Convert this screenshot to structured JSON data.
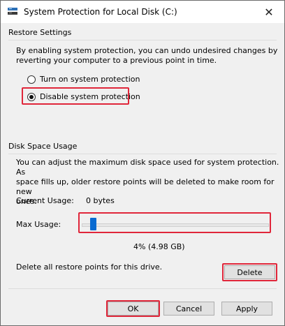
{
  "window": {
    "title": "System Protection for Local Disk (C:)",
    "close_glyph": "✕"
  },
  "restore_settings": {
    "heading": "Restore Settings",
    "description_line1": "By enabling system protection, you can undo undesired changes by",
    "description_line2": "reverting your computer to a previous point in time.",
    "options": [
      {
        "label": "Turn on system protection",
        "selected": false
      },
      {
        "label": "Disable system protection",
        "selected": true
      }
    ]
  },
  "disk_space": {
    "heading": "Disk Space Usage",
    "description_line1": "You can adjust the maximum disk space used for system protection. As",
    "description_line2": "space fills up, older restore points will be deleted to make room for new",
    "description_line3": "ones.",
    "current_usage_label": "Current Usage:",
    "current_usage_value": "0 bytes",
    "max_usage_label": "Max Usage:",
    "max_usage_percent": 4,
    "max_usage_readout": "4% (4.98 GB)",
    "delete_text": "Delete all restore points for this drive.",
    "delete_button": "Delete"
  },
  "footer": {
    "ok_label": "OK",
    "cancel_label": "Cancel",
    "apply_label": "Apply"
  },
  "colors": {
    "highlight_box": "#e0263a",
    "slider_thumb": "#0a6bd1"
  }
}
